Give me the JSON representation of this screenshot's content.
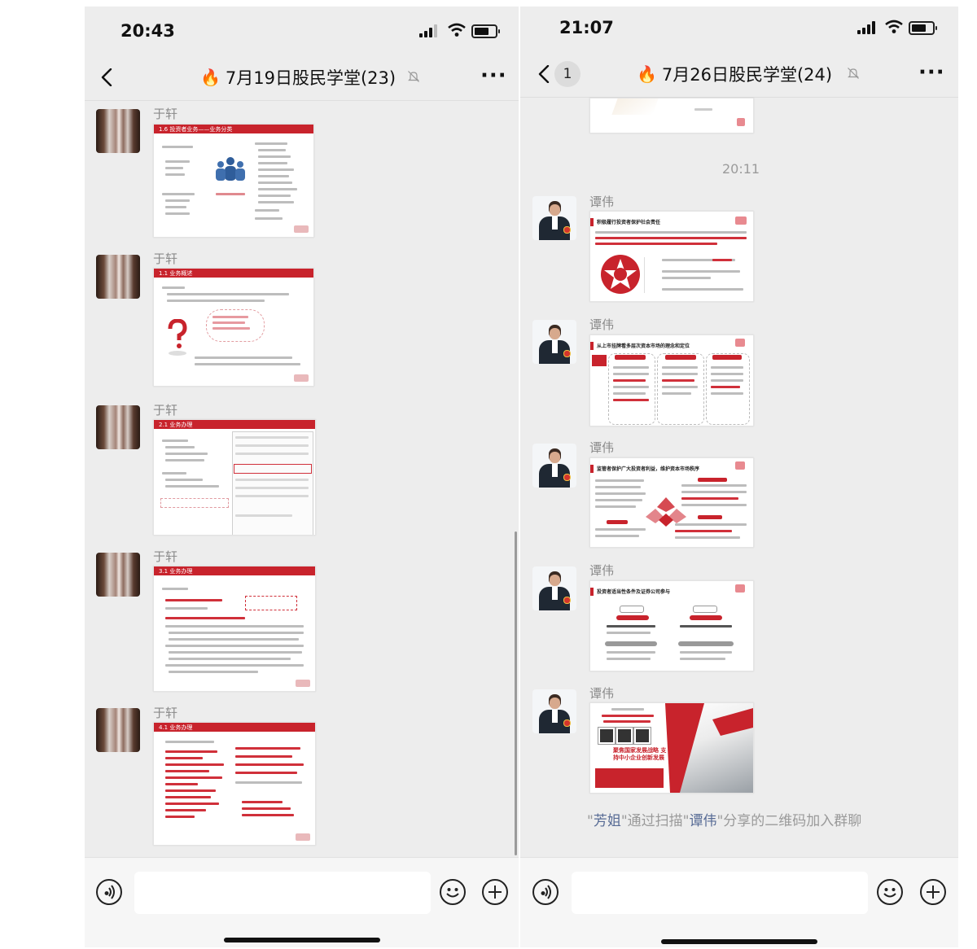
{
  "left": {
    "status_time": "20:43",
    "title": "7月19日股民学堂(23)",
    "messages": [
      {
        "sender": "于轩",
        "slide": "1.6 投资者业务——业务分类"
      },
      {
        "sender": "于轩",
        "slide": "1.1 业务概述"
      },
      {
        "sender": "于轩",
        "slide": "2.1 业务办理"
      },
      {
        "sender": "于轩",
        "slide": "3.1 业务办理"
      },
      {
        "sender": "于轩",
        "slide": "4.1 业务办理"
      }
    ]
  },
  "right": {
    "status_time": "21:07",
    "unread": "1",
    "title": "7月26日股民学堂(24)",
    "time_divider": "20:11",
    "messages": [
      {
        "sender": "谭伟",
        "slide": "积极履行投资者保护社会责任"
      },
      {
        "sender": "谭伟",
        "slide": "从上市挂牌看多层次资本市场的理念和定位"
      },
      {
        "sender": "谭伟",
        "slide": "监管者保护广大投资者利益，维护资本市场秩序"
      },
      {
        "sender": "谭伟",
        "slide": "投资者适当性条件及证券公司参与"
      },
      {
        "sender": "谭伟",
        "slide": "聚焦国家发展战略 支持中小企业创新发展"
      }
    ],
    "system_message": {
      "prefix": "\"",
      "user": "芳姐",
      "middle": "\"通过扫描\"",
      "sharer": "谭伟",
      "suffix": "\"分享的二维码加入群聊"
    }
  },
  "icons": {
    "back": "chevron-left-icon",
    "mute": "bell-mute-icon",
    "more": "more-dots-icon",
    "fire": "fire-icon",
    "voice": "voice-icon",
    "emoji": "emoji-icon",
    "plus": "plus-icon"
  },
  "colors": {
    "chat_bg": "#ededed",
    "accent_red": "#c8232c",
    "link": "#576b95"
  }
}
